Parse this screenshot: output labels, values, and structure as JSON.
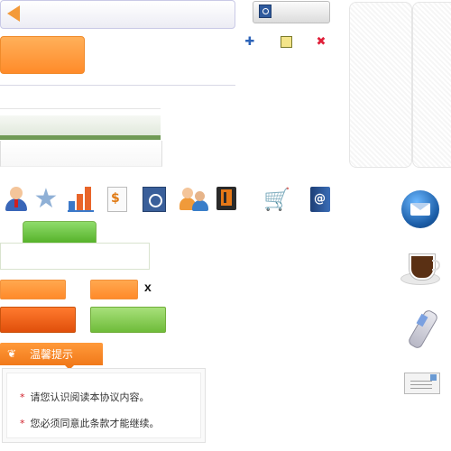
{
  "toolbar": {
    "back_icon": "back-arrow-icon",
    "search_icon": "search-icon",
    "add_icon": "add-icon",
    "edit_icon": "edit-icon",
    "delete_icon": "delete-icon"
  },
  "progress": {
    "value": 1.0,
    "color": "#6f9a55"
  },
  "icons": [
    "user-icon",
    "star-icon",
    "bar-chart-icon",
    "document-icon",
    "address-book-icon",
    "users-icon",
    "flash-icon",
    "cart-icon",
    "contacts-icon"
  ],
  "right_icons": [
    "mail-icon",
    "coffee-icon",
    "mobile-phone-icon",
    "letter-icon"
  ],
  "close_label": "x",
  "notice": {
    "title": "温馨提示",
    "lines": [
      "请您认识阅读本协议内容。",
      "您必须同意此条款才能继续。"
    ]
  },
  "colors": {
    "orange": "#ff8b2a",
    "red_orange": "#e04f0b",
    "green": "#6fbc3a",
    "accent_blue": "#1c5ea8"
  }
}
